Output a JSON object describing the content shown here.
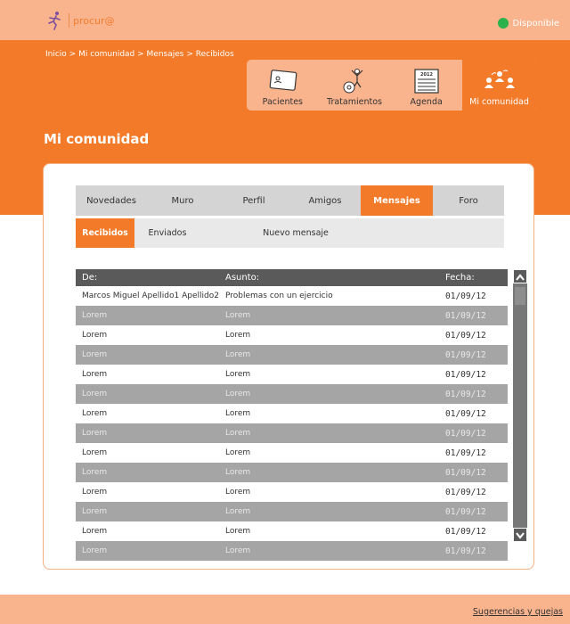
{
  "header": {
    "logo_text": "procur@",
    "status_label": "Disponible",
    "status_color": "#2bb24c"
  },
  "breadcrumb": "Inicio > Mi comunidad > Mensajes > Recibidos",
  "nav": [
    {
      "label": "Pacientes",
      "icon": "patient-card-icon"
    },
    {
      "label": "Tratamientos",
      "icon": "treatment-icon"
    },
    {
      "label": "Agenda",
      "icon": "calendar-icon",
      "icon_text": "2012"
    },
    {
      "label": "Mi comunidad",
      "icon": "community-icon",
      "active": true
    }
  ],
  "page_title": "Mi comunidad",
  "tabs": [
    "Novedades",
    "Muro",
    "Perfil",
    "Amigos",
    "Mensajes",
    "Foro"
  ],
  "active_tab": "Mensajes",
  "subtabs": [
    "Recibidos",
    "Enviados",
    "Nuevo mensaje"
  ],
  "active_subtab": "Recibidos",
  "table": {
    "headers": [
      "De:",
      "Asunto:",
      "Fecha:"
    ],
    "rows": [
      [
        "Marcos Miguel Apellido1 Apellido2",
        "Problemas con un ejercicio",
        "01/09/12"
      ],
      [
        "Lorem",
        "Lorem",
        "01/09/12"
      ],
      [
        "Lorem",
        "Lorem",
        "01/09/12"
      ],
      [
        "Lorem",
        "Lorem",
        "01/09/12"
      ],
      [
        "Lorem",
        "Lorem",
        "01/09/12"
      ],
      [
        "Lorem",
        "Lorem",
        "01/09/12"
      ],
      [
        "Lorem",
        "Lorem",
        "01/09/12"
      ],
      [
        "Lorem",
        "Lorem",
        "01/09/12"
      ],
      [
        "Lorem",
        "Lorem",
        "01/09/12"
      ],
      [
        "Lorem",
        "Lorem",
        "01/09/12"
      ],
      [
        "Lorem",
        "Lorem",
        "01/09/12"
      ],
      [
        "Lorem",
        "Lorem",
        "01/09/12"
      ],
      [
        "Lorem",
        "Lorem",
        "01/09/12"
      ],
      [
        "Lorem",
        "Lorem",
        "01/09/12"
      ]
    ]
  },
  "footer": {
    "link": "Sugerencias y quejas"
  },
  "colors": {
    "accent": "#f37a29",
    "accent_light": "#f9b48d"
  }
}
